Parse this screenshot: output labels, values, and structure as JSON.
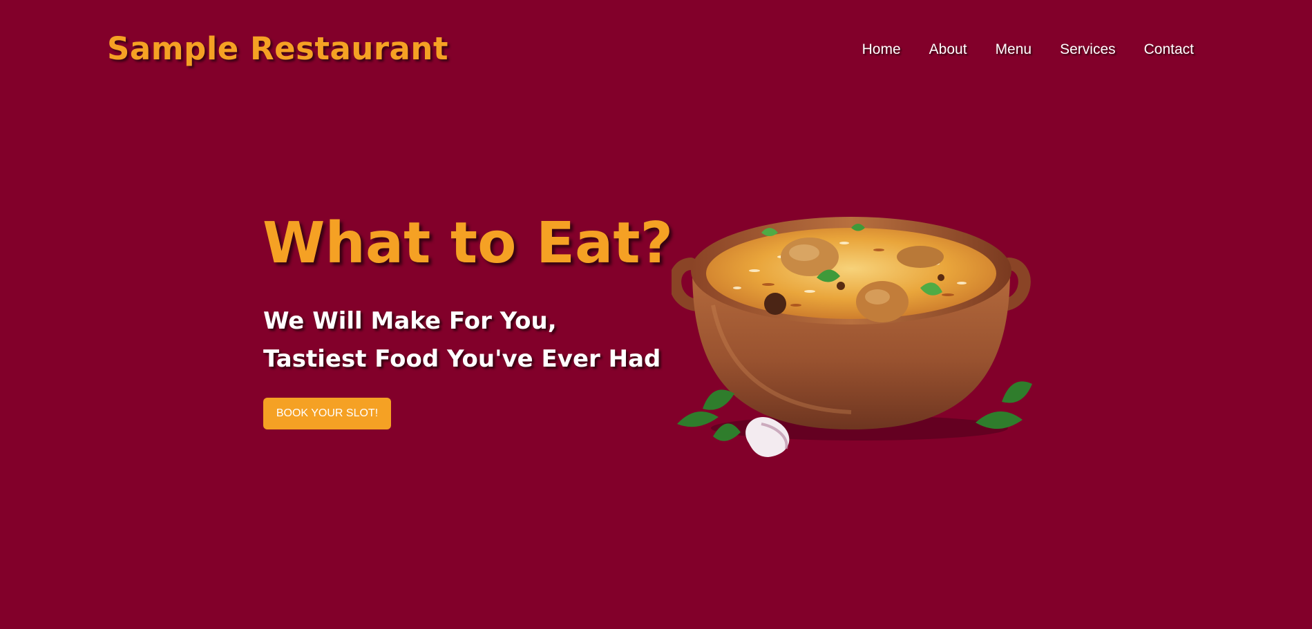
{
  "header": {
    "brand": "Sample Restaurant",
    "nav": [
      "Home",
      "About",
      "Menu",
      "Services",
      "Contact"
    ]
  },
  "hero": {
    "title": "What to Eat?",
    "subtitle_line1": "We Will Make For You,",
    "subtitle_line2": "Tastiest Food You've Ever Had",
    "cta_label": "BOOK YOUR SLOT!"
  },
  "image": {
    "icon": "biryani-bowl-image"
  },
  "colors": {
    "background": "#82002a",
    "accent": "#f5a124",
    "text": "#ffffff"
  }
}
